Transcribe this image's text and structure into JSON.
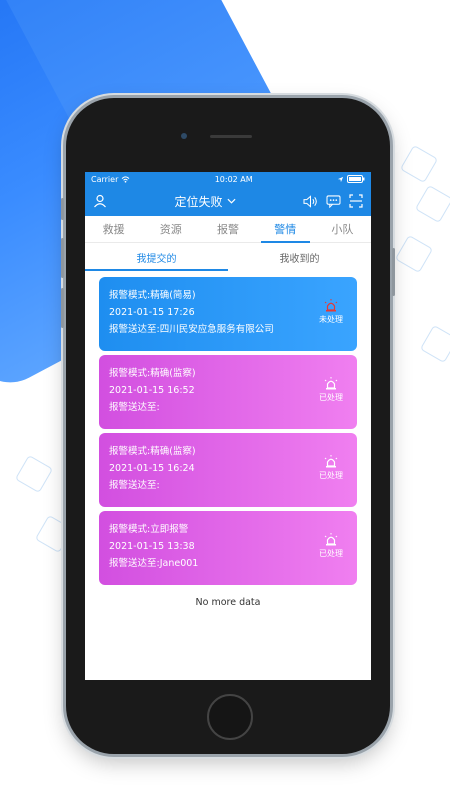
{
  "status_bar": {
    "carrier": "Carrier",
    "time": "10:02 AM"
  },
  "app_bar": {
    "title": "定位失败"
  },
  "tabs": [
    {
      "label": "救援",
      "active": false
    },
    {
      "label": "资源",
      "active": false
    },
    {
      "label": "报警",
      "active": false
    },
    {
      "label": "警情",
      "active": true
    },
    {
      "label": "小队",
      "active": false
    }
  ],
  "sub_tabs": [
    {
      "label": "我提交的",
      "active": true
    },
    {
      "label": "我收到的",
      "active": false
    }
  ],
  "alerts": [
    {
      "mode": "报警模式:精确(简易)",
      "time": "2021-01-15 17:26",
      "sent_to": "报警送达至:四川民安应急服务有限公司",
      "status": "未处理",
      "style": "blue",
      "icon_color": "#e53935"
    },
    {
      "mode": "报警模式:精确(监察)",
      "time": "2021-01-15 16:52",
      "sent_to": "报警送达至:",
      "status": "已处理",
      "style": "pink",
      "icon_color": "#ffffff"
    },
    {
      "mode": "报警模式:精确(监察)",
      "time": "2021-01-15 16:24",
      "sent_to": "报警送达至:",
      "status": "已处理",
      "style": "pink",
      "icon_color": "#ffffff"
    },
    {
      "mode": "报警模式:立即报警",
      "time": "2021-01-15 13:38",
      "sent_to": "报警送达至:Jane001",
      "status": "已处理",
      "style": "pink",
      "icon_color": "#ffffff"
    }
  ],
  "footer": {
    "no_more": "No more data"
  },
  "colors": {
    "accent": "#1e88e5",
    "unhandled": "#e53935"
  }
}
